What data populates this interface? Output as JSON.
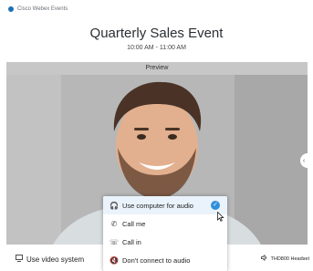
{
  "app": {
    "name": "Cisco Webex Events"
  },
  "meeting": {
    "title": "Quarterly Sales Event",
    "time": "10:00 AM - 11:00 AM"
  },
  "preview": {
    "label": "Preview"
  },
  "audio_menu": {
    "items": [
      {
        "label": "Use computer for audio",
        "icon": "headphones-icon",
        "selected": true
      },
      {
        "label": "Call me",
        "icon": "phone-icon",
        "selected": false
      },
      {
        "label": "Call in",
        "icon": "phone-incoming-icon",
        "selected": false
      },
      {
        "label": "Don't connect to audio",
        "icon": "speaker-mute-icon",
        "selected": false
      }
    ]
  },
  "bottom": {
    "video_system_label": "Use video system",
    "headset_label": "THD800 Headset"
  },
  "colors": {
    "accent": "#2f8fdc",
    "selected_bg": "#eaf3fb",
    "preview_bar": "#c7c7c7"
  }
}
